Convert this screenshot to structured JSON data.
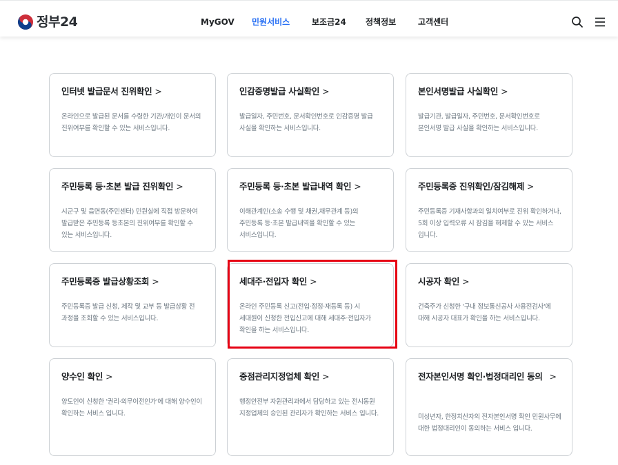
{
  "header": {
    "logo_text": "정부24",
    "nav": [
      {
        "label": "MyGOV",
        "active": false
      },
      {
        "label": "민원서비스",
        "active": true
      },
      {
        "label": "보조금24",
        "active": false
      },
      {
        "label": "정책정보",
        "active": false
      },
      {
        "label": "고객센터",
        "active": false
      }
    ],
    "search_icon": "search-icon",
    "menu_icon": "hamburger-menu-icon"
  },
  "colors": {
    "accent": "#256ef4",
    "highlight_box": "#e60012",
    "card_border": "#cdd1d5",
    "desc_text": "#6d7882"
  },
  "cards": [
    {
      "title": "인터넷 발급문서 진위확인",
      "chevron": ">",
      "desc": "온라인으로 발급된 문서를 수령한 기관/개인이 문서의 진위여부를 확인할 수 있는 서비스입니다."
    },
    {
      "title": "인감증명발급 사실확인",
      "chevron": ">",
      "desc": "발급일자, 주민번호, 문서확인번호로 인감증명 발급 사실을 확인하는 서비스입니다."
    },
    {
      "title": "본인서명발급 사실확인",
      "chevron": ">",
      "desc": "발급기관, 발급일자, 주민번호, 문서확인번호로 본인서명 발급 사실을 확인하는 서비스입니다."
    },
    {
      "title": "주민등록 등·초본 발급 진위확인",
      "chevron": ">",
      "desc": "시군구 및 읍면동(주민센터) 민원실에 직접 방문하여 발급받은 주민등록 등초본의 진위여부를 확인할 수 있는 서비스입니다."
    },
    {
      "title": "주민등록 등·초본 발급내역 확인",
      "chevron": ">",
      "desc": "이해관계인(소송 수행 및 채권,채무관계 등)의 주민등록 등·초본 발급내역을 확인할 수 있는 서비스입니다."
    },
    {
      "title": "주민등록증 진위확인/잠김해제",
      "chevron": ">",
      "desc": "주민등록증 기재사항과의 일치여부로 진위 확인하거나, 5회 이상 입력오류 시 잠김을 해제할 수 있는 서비스 입니다."
    },
    {
      "title": "주민등록증 발급상황조회",
      "chevron": ">",
      "desc": "주민등록증 발급 신청, 제작 및 교부 등 발급상황 전 과정을 조회할 수 있는 서비스입니다."
    },
    {
      "title": "세대주·전입자 확인",
      "chevron": ">",
      "desc": "온라인 주민등록 신고(전입·정정·재등록 등) 시 세대원이 신청한 전입신고에 대해 세대주·전입자가 확인을 하는 서비스입니다."
    },
    {
      "title": "시공자 확인",
      "chevron": ">",
      "desc": "건축주가 신청한 '구내 정보통신공사 사용전검사'에 대해 시공자 대표가 확인을 하는 서비스입니다."
    },
    {
      "title": "양수인 확인",
      "chevron": ">",
      "desc": "양도인이 신청한 '권리·의무이전인가'에 대해 양수인이 확인하는 서비스 입니다."
    },
    {
      "title": "중점관리지정업체 확인",
      "chevron": ">",
      "desc": "행정안전부 자원관리과에서 담당하고 있는 전시동원 지정업체의 승인된 관리자가 확인하는 서비스 입니다."
    },
    {
      "title": "전자본인서명 확인·법정대리인 동의",
      "chevron": ">",
      "desc": "미성년자, 한정치산자의 전자본인서명 확인 민원사무에 대한 법정대리인이 동의하는 서비스 입니다."
    }
  ]
}
